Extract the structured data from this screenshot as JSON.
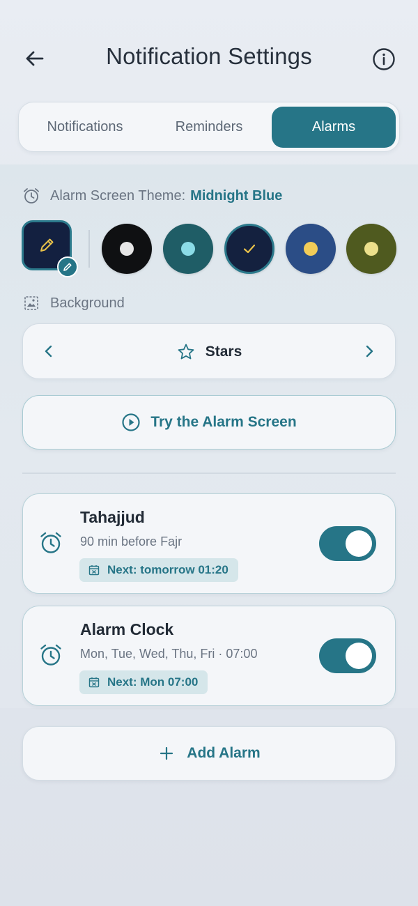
{
  "header": {
    "title": "Notification Settings",
    "back_icon": "arrow-left-icon",
    "info_icon": "info-icon"
  },
  "tabs": [
    {
      "label": "Notifications",
      "active": false
    },
    {
      "label": "Reminders",
      "active": false
    },
    {
      "label": "Alarms",
      "active": true
    }
  ],
  "theme": {
    "label": "Alarm Screen Theme:",
    "value": "Midnight Blue",
    "icon": "alarm-clock-icon",
    "swatches": [
      {
        "name": "black",
        "color": "#0f1012",
        "dot": "#e6e6e6",
        "selected": false
      },
      {
        "name": "teal",
        "color": "#1f5d66",
        "dot": "#8bdbe6",
        "selected": false
      },
      {
        "name": "midnight-blue",
        "color": "#14213f",
        "dot": "#e9c24a",
        "selected": true
      },
      {
        "name": "royal-blue",
        "color": "#2b4d86",
        "dot": "#f2cc58",
        "selected": false
      },
      {
        "name": "olive",
        "color": "#4f5a1f",
        "dot": "#ece08c",
        "selected": false
      }
    ]
  },
  "background": {
    "label": "Background",
    "icon": "image-icon",
    "value": "Stars",
    "value_icon": "star-icon"
  },
  "try_button": {
    "label": "Try the Alarm Screen",
    "icon": "play-circle-icon"
  },
  "alarms": [
    {
      "name": "Tahajjud",
      "subtitle": "90 min before Fajr",
      "next": "Next: tomorrow 01:20",
      "enabled": true
    },
    {
      "name": "Alarm Clock",
      "subtitle": "Mon, Tue, Wed, Thu, Fri · 07:00",
      "next": "Next: Mon 07:00",
      "enabled": true
    }
  ],
  "add_button": {
    "label": "Add Alarm",
    "icon": "plus-icon"
  },
  "colors": {
    "accent": "#267587",
    "swatch_border": "#2c7a8c",
    "card_border": "#b8d2d9",
    "chip_bg": "#d5e6ea"
  }
}
